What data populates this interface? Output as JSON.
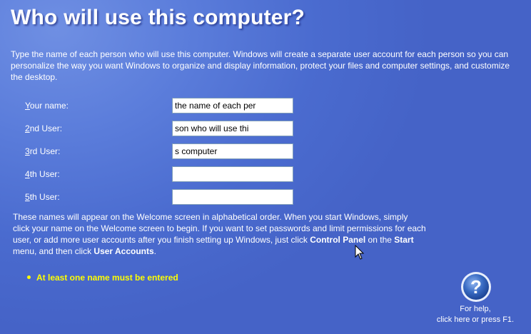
{
  "page": {
    "title": "Who will use this computer?",
    "intro": "Type the name of each person who will use this computer. Windows will create a separate user account for each person so you can personalize the way you want Windows to organize and display information, protect your files and computer settings, and customize the desktop."
  },
  "fields": [
    {
      "access_key": "Y",
      "label_rest": "our name:",
      "value": "the name of each per"
    },
    {
      "access_key": "2",
      "label_rest": "nd User:",
      "value": "son who will use thi"
    },
    {
      "access_key": "3",
      "label_rest": "rd User:",
      "value": "s computer"
    },
    {
      "access_key": "4",
      "label_rest": "th User:",
      "value": ""
    },
    {
      "access_key": "5",
      "label_rest": "th User:",
      "value": ""
    }
  ],
  "note": {
    "part1": "These names will appear on the Welcome screen in alphabetical order. When you start Windows, simply click your name on the Welcome screen to begin. If you want to set passwords and limit permissions for each user, or add more user accounts after you finish setting up Windows, just click ",
    "control_panel": "Control Panel",
    "part2": " on the ",
    "start": "Start",
    "part3": " menu, and then click ",
    "user_accounts": "User Accounts",
    "part4": "."
  },
  "warning": "At least one name must be entered",
  "help": {
    "line1": "For help,",
    "line2": "click here or press F1."
  },
  "colors": {
    "background": "#5b7ddb",
    "warning": "#ffff00",
    "help_icon": "#2f5fb3"
  },
  "icons": {
    "help": "question-mark-circle-icon",
    "cursor": "mouse-pointer-icon"
  }
}
